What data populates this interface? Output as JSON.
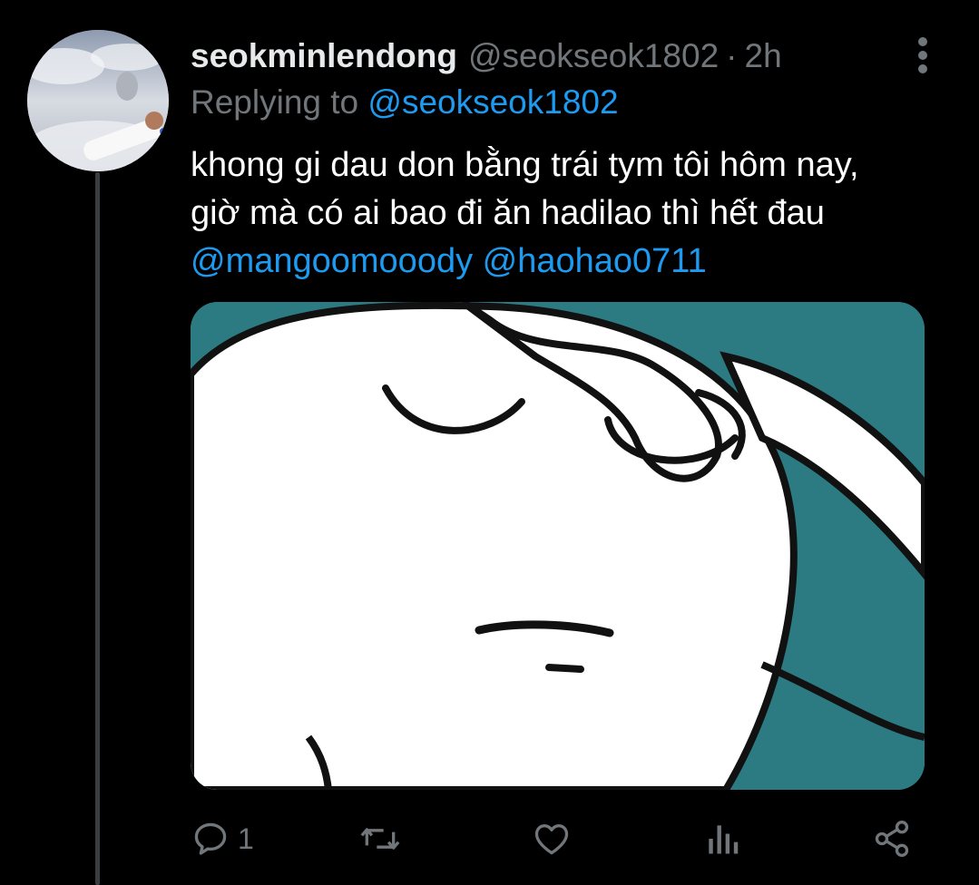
{
  "tweet": {
    "display_name": "seokminlendong",
    "handle": "@seokseok1802",
    "separator": "·",
    "time": "2h",
    "replying_prefix": "Replying to",
    "replying_to": "@seokseok1802",
    "text_line_1": "khong gi dau don bằng trái tym tôi hôm nay,",
    "text_line_2": "giờ mà có ai bao đi ăn hadilao thì hết đau",
    "mention_1": "@mangoomooody",
    "mention_2": "@haohao0711"
  },
  "media": {
    "description_icon": "cartoon-face-image",
    "background_color": "#2c7b83"
  },
  "actions": {
    "reply_icon": "reply-icon",
    "reply_count": "1",
    "retweet_icon": "retweet-icon",
    "like_icon": "heart-icon",
    "analytics_icon": "analytics-icon",
    "share_icon": "share-icon"
  },
  "colors": {
    "background": "#000000",
    "accent": "#1d9bf0",
    "muted": "#71767b",
    "text": "#ffffff"
  }
}
